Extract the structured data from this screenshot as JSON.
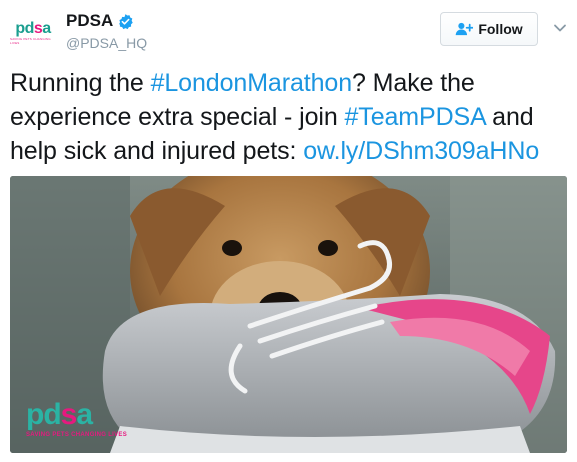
{
  "account": {
    "display_name": "PDSA",
    "handle": "@PDSA_HQ",
    "avatar_logo": {
      "pre": "pd",
      "o": "s",
      "post": "a",
      "sub": "Saving pets changing lives"
    }
  },
  "follow_button": {
    "label": "Follow"
  },
  "tweet": {
    "segments": [
      {
        "text": "Running the ",
        "link": false
      },
      {
        "text": "#LondonMarathon",
        "link": true
      },
      {
        "text": "? Make the experience extra special - join ",
        "link": false
      },
      {
        "text": "#TeamPDSA",
        "link": true
      },
      {
        "text": " and help sick and injured pets: ",
        "link": false
      },
      {
        "text": "ow.ly/DShm309aHNo",
        "link": true
      }
    ]
  },
  "photo": {
    "logo": {
      "pre": "pd",
      "o": "s",
      "post": "a"
    },
    "tagline": "Saving pets changing lives"
  },
  "colors": {
    "link": "#1b95e0",
    "verified": "#1da1f2",
    "brand_teal": "#2bb3a4",
    "brand_pink": "#e6197f"
  },
  "icons": {
    "verified": "verified-badge-icon",
    "follow": "add-user-icon",
    "caret": "chevron-down-icon"
  }
}
